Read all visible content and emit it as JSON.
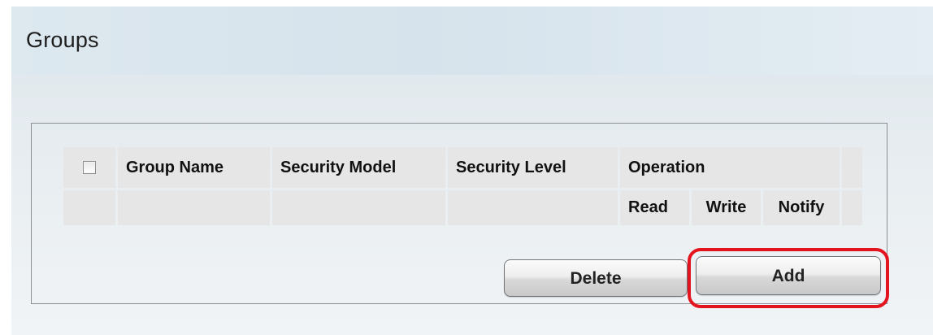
{
  "page": {
    "title": "Groups"
  },
  "table": {
    "headers": {
      "group_name": "Group Name",
      "security_model": "Security Model",
      "security_level": "Security Level",
      "operation": "Operation"
    },
    "sub_headers": {
      "read": "Read",
      "write": "Write",
      "notify": "Notify"
    },
    "select_all_checked": false,
    "rows": []
  },
  "buttons": {
    "delete_label": "Delete",
    "add_label": "Add"
  },
  "colors": {
    "highlight": "#e3141e",
    "header_cell": "#e6e6e6",
    "header_band": "#d6e3ec"
  }
}
